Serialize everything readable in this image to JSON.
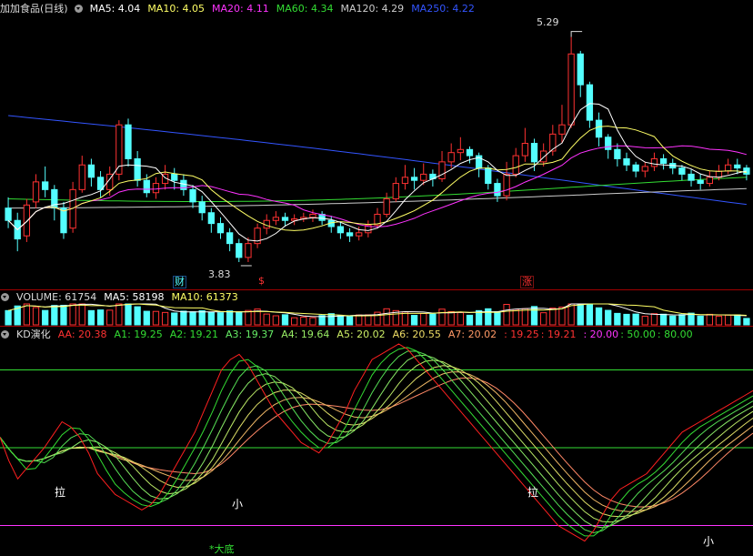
{
  "colors": {
    "up": "#ff3232",
    "down": "#54ffff",
    "ma5": "#ffffff",
    "ma10": "#ffff66",
    "ma20": "#ff33ff",
    "ma60": "#33dd33",
    "ma120": "#cccccc",
    "ma250": "#3355ff",
    "grid_red": "#a00000"
  },
  "main": {
    "title": "加加食品(日线)",
    "ma5": "MA5: 4.04",
    "ma10": "MA10: 4.05",
    "ma20": "MA20: 4.11",
    "ma60": "MA60: 4.34",
    "ma120": "MA120: 4.29",
    "ma250": "MA250: 4.22",
    "high_mark": "5.29",
    "low_mark": "3.83",
    "mark_cai": "财",
    "mark_s": "$",
    "mark_zhang": "涨"
  },
  "volume": {
    "title": "VOLUME: 61754",
    "ma5": "MA5: 58198",
    "ma10": "MA10: 61373"
  },
  "kd": {
    "title": "KD演化",
    "aa": "AA: 20.38",
    "a1": "A1: 19.25",
    "a2": "A2: 19.21",
    "a3": "A3: 19.37",
    "a4": "A4: 19.64",
    "a5": "A5: 20.02",
    "a6": "A6: 20.55",
    "a7": "A7: 20.02",
    "v1": ": 19.25",
    "v2": ": 19.21",
    "v3": ": 20.00",
    "v4": ": 50.00",
    "v5": ": 80.00",
    "la1": "拉",
    "la2": "拉",
    "xiao1": "小",
    "xiao2": "小",
    "dadi": "*大底"
  },
  "chart_data": [
    {
      "type": "candlestick",
      "price_range": [
        3.7,
        5.4
      ],
      "candles": [
        [
          4.18,
          4.1,
          4.25,
          4.05
        ],
        [
          4.1,
          3.98,
          4.15,
          3.9
        ],
        [
          4.0,
          4.2,
          4.24,
          3.96
        ],
        [
          4.22,
          4.35,
          4.4,
          4.18
        ],
        [
          4.35,
          4.3,
          4.45,
          4.25
        ],
        [
          4.3,
          4.18,
          4.33,
          4.1
        ],
        [
          4.18,
          4.02,
          4.22,
          3.98
        ],
        [
          4.05,
          4.3,
          4.35,
          4.02
        ],
        [
          4.3,
          4.46,
          4.52,
          4.28
        ],
        [
          4.46,
          4.38,
          4.5,
          4.32
        ],
        [
          4.38,
          4.3,
          4.42,
          4.25
        ],
        [
          4.3,
          4.4,
          4.45,
          4.26
        ],
        [
          4.4,
          4.72,
          4.75,
          4.36
        ],
        [
          4.72,
          4.5,
          4.76,
          4.45
        ],
        [
          4.5,
          4.36,
          4.55,
          4.32
        ],
        [
          4.36,
          4.28,
          4.4,
          4.25
        ],
        [
          4.28,
          4.34,
          4.38,
          4.24
        ],
        [
          4.34,
          4.4,
          4.46,
          4.3
        ],
        [
          4.4,
          4.36,
          4.44,
          4.3
        ],
        [
          4.36,
          4.3,
          4.4,
          4.26
        ],
        [
          4.3,
          4.22,
          4.33,
          4.18
        ],
        [
          4.22,
          4.15,
          4.26,
          4.1
        ],
        [
          4.15,
          4.08,
          4.18,
          4.02
        ],
        [
          4.08,
          4.02,
          4.12,
          3.98
        ],
        [
          4.02,
          3.95,
          4.05,
          3.9
        ],
        [
          3.95,
          3.86,
          3.98,
          3.83
        ],
        [
          3.86,
          3.95,
          3.99,
          3.83
        ],
        [
          3.95,
          4.05,
          4.08,
          3.92
        ],
        [
          4.05,
          4.1,
          4.14,
          4.01
        ],
        [
          4.1,
          4.12,
          4.16,
          4.07
        ],
        [
          4.12,
          4.1,
          4.15,
          4.06
        ],
        [
          4.1,
          4.11,
          4.14,
          4.07
        ],
        [
          4.11,
          4.12,
          4.15,
          4.09
        ],
        [
          4.12,
          4.14,
          4.17,
          4.09
        ],
        [
          4.14,
          4.1,
          4.16,
          4.07
        ],
        [
          4.1,
          4.06,
          4.13,
          4.02
        ],
        [
          4.06,
          4.02,
          4.09,
          3.98
        ],
        [
          4.02,
          4.0,
          4.05,
          3.96
        ],
        [
          4.0,
          4.02,
          4.06,
          3.97
        ],
        [
          4.02,
          4.07,
          4.1,
          3.99
        ],
        [
          4.07,
          4.14,
          4.18,
          4.05
        ],
        [
          4.14,
          4.24,
          4.28,
          4.12
        ],
        [
          4.24,
          4.34,
          4.38,
          4.22
        ],
        [
          4.34,
          4.38,
          4.46,
          4.3
        ],
        [
          4.38,
          4.36,
          4.44,
          4.3
        ],
        [
          4.36,
          4.4,
          4.47,
          4.33
        ],
        [
          4.4,
          4.37,
          4.43,
          4.32
        ],
        [
          4.37,
          4.48,
          4.55,
          4.35
        ],
        [
          4.48,
          4.54,
          4.6,
          4.44
        ],
        [
          4.54,
          4.56,
          4.64,
          4.49
        ],
        [
          4.56,
          4.52,
          4.58,
          4.47
        ],
        [
          4.52,
          4.44,
          4.54,
          4.38
        ],
        [
          4.44,
          4.34,
          4.46,
          4.3
        ],
        [
          4.34,
          4.26,
          4.37,
          4.22
        ],
        [
          4.26,
          4.4,
          4.48,
          4.23
        ],
        [
          4.4,
          4.52,
          4.57,
          4.38
        ],
        [
          4.52,
          4.6,
          4.7,
          4.48
        ],
        [
          4.6,
          4.48,
          4.63,
          4.42
        ],
        [
          4.48,
          4.55,
          4.6,
          4.45
        ],
        [
          4.55,
          4.66,
          4.72,
          4.52
        ],
        [
          4.66,
          4.72,
          4.85,
          4.6
        ],
        [
          4.72,
          5.18,
          5.29,
          4.7
        ],
        [
          5.18,
          4.98,
          5.2,
          4.9
        ],
        [
          4.98,
          4.75,
          5.0,
          4.7
        ],
        [
          4.75,
          4.64,
          4.8,
          4.58
        ],
        [
          4.64,
          4.56,
          4.66,
          4.5
        ],
        [
          4.56,
          4.5,
          4.6,
          4.45
        ],
        [
          4.5,
          4.46,
          4.54,
          4.42
        ],
        [
          4.46,
          4.42,
          4.48,
          4.38
        ],
        [
          4.42,
          4.45,
          4.48,
          4.38
        ],
        [
          4.45,
          4.5,
          4.54,
          4.42
        ],
        [
          4.5,
          4.47,
          4.53,
          4.43
        ],
        [
          4.47,
          4.44,
          4.5,
          4.4
        ],
        [
          4.44,
          4.4,
          4.46,
          4.36
        ],
        [
          4.4,
          4.36,
          4.43,
          4.32
        ],
        [
          4.36,
          4.34,
          4.4,
          4.3
        ],
        [
          4.34,
          4.38,
          4.42,
          4.32
        ],
        [
          4.38,
          4.42,
          4.46,
          4.36
        ],
        [
          4.42,
          4.46,
          4.5,
          4.4
        ],
        [
          4.46,
          4.44,
          4.5,
          4.4
        ],
        [
          4.44,
          4.4,
          4.46,
          4.36
        ]
      ],
      "ma5_last": 4.04,
      "ma10_last": 4.05,
      "ma20_last": 4.11,
      "ma60_last": 4.34,
      "ma120_last": 4.29,
      "ma250_last": 4.22,
      "high": 5.29,
      "low": 3.83
    },
    {
      "type": "bar",
      "series_name": "VOLUME",
      "volume_range": [
        0,
        200000
      ],
      "last": 61754,
      "ma5": 58198,
      "ma10": 61373
    },
    {
      "type": "line",
      "series_name": "KD演化",
      "y_range": [
        10,
        90
      ],
      "levels": [
        20,
        50,
        80
      ],
      "aa": [
        54,
        45,
        38,
        42,
        46,
        50,
        55,
        60,
        58,
        54,
        48,
        40,
        36,
        32,
        30,
        28,
        26,
        28,
        32,
        38,
        44,
        50,
        56,
        64,
        72,
        80,
        84,
        86,
        82,
        76,
        70,
        64,
        60,
        56,
        52,
        50,
        48,
        52,
        58,
        64,
        72,
        78,
        84,
        86,
        88,
        90,
        88,
        84,
        80,
        76,
        72,
        68,
        64,
        60,
        56,
        52,
        48,
        44,
        40,
        36,
        32,
        28,
        24,
        20,
        18,
        16,
        14,
        18,
        24,
        30,
        34,
        36,
        38,
        40,
        44,
        48,
        52,
        56,
        58,
        60,
        62,
        64,
        66,
        68,
        70,
        72
      ],
      "a_last": [
        19.25,
        19.21,
        19.37,
        19.64,
        20.02,
        20.55,
        20.02
      ],
      "aa_last": 20.38
    }
  ]
}
